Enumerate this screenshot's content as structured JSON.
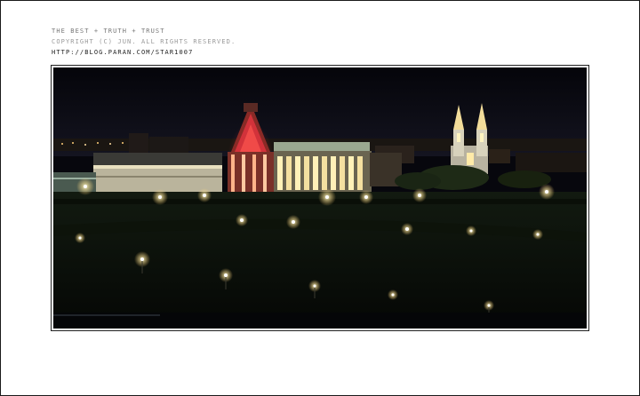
{
  "caption": {
    "line1": "THE BEST + TRUTH + TRUST",
    "line2": "COPYRIGHT (C) JUN. ALL RIGHTS RESERVED.",
    "line3": "HTTP://BLOG.PARAN.COM/STAR1007"
  },
  "photo": {
    "subject": "night-cityscape",
    "colors": {
      "sky": "#08080f",
      "glass_tower": "#d2323a",
      "building": "#c9c3a8",
      "lights": "#fff6c8",
      "trees": "#0f1a0c"
    }
  }
}
